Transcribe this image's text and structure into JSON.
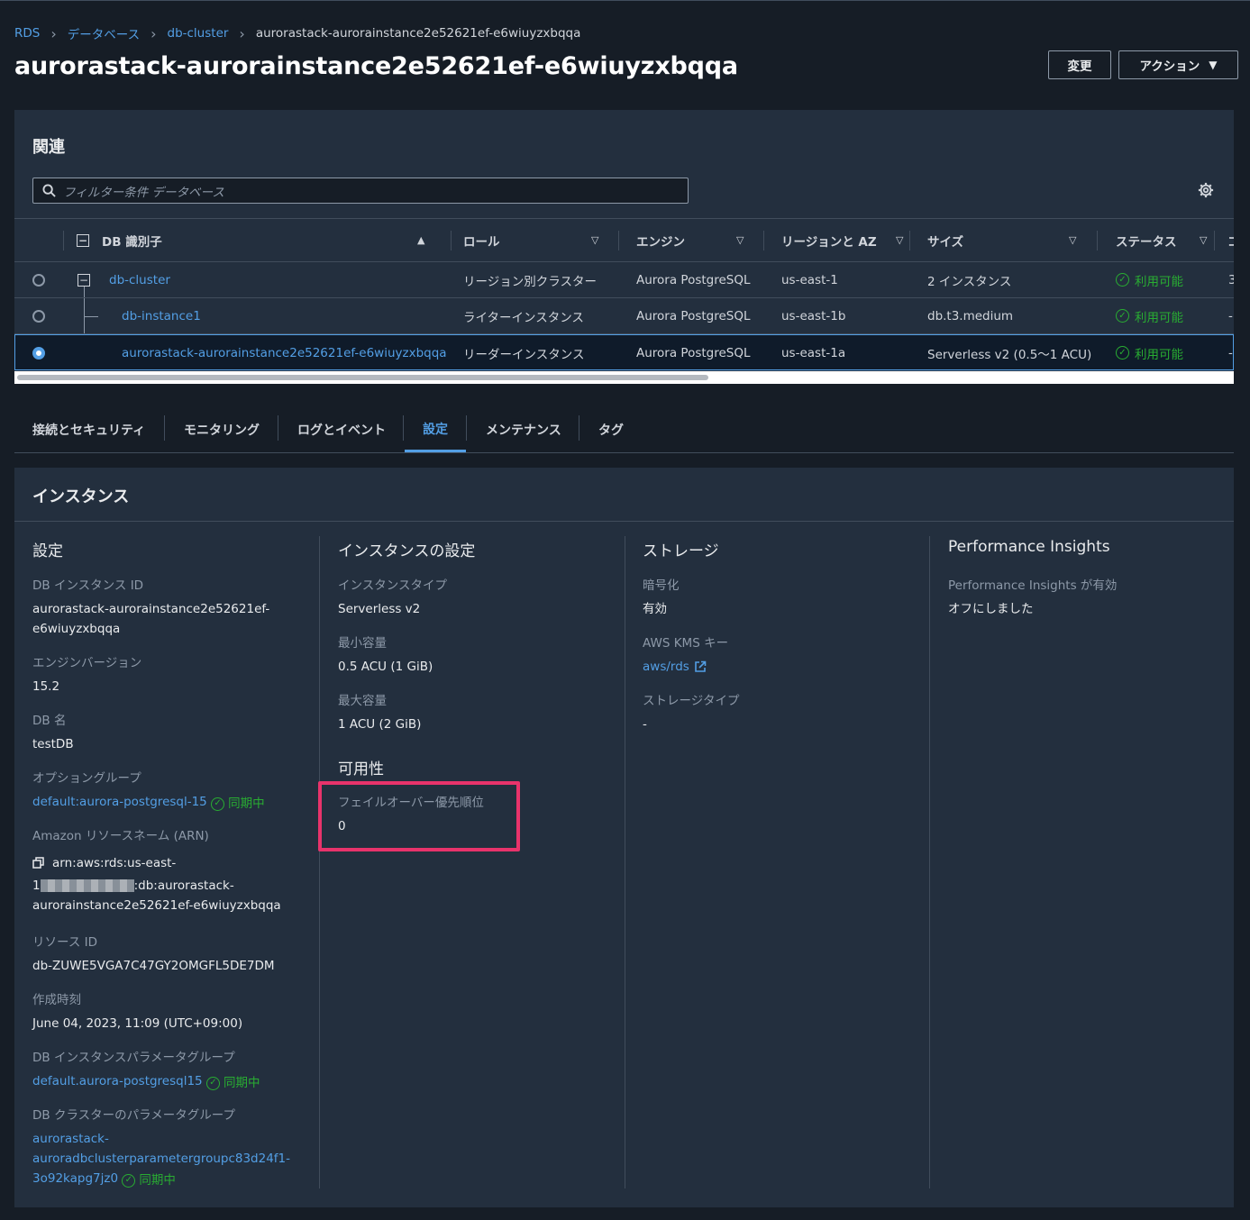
{
  "breadcrumb": {
    "rds": "RDS",
    "databases": "データベース",
    "cluster": "db-cluster",
    "current": "aurorastack-aurorainstance2e52621ef-e6wiuyzxbqqa",
    "separator": ">"
  },
  "page_title": "aurorastack-aurorainstance2e52621ef-e6wiuyzxbqqa",
  "header_buttons": {
    "change": "変更",
    "action": "アクション"
  },
  "related": {
    "title": "関連",
    "search_placeholder": "フィルター条件 データベース",
    "columns": {
      "id": "DB 識別子",
      "role": "ロール",
      "engine": "エンジン",
      "region": "リージョンと AZ",
      "size": "サイズ",
      "status": "ステータス"
    },
    "rows": [
      {
        "id": "db-cluster",
        "role": "リージョン別クラスター",
        "engine": "Aurora PostgreSQL",
        "region": "us-east-1",
        "size": "2 インスタンス",
        "status": "利用可能",
        "extra": "3"
      },
      {
        "id": "db-instance1",
        "role": "ライターインスタンス",
        "engine": "Aurora PostgreSQL",
        "region": "us-east-1b",
        "size": "db.t3.medium",
        "status": "利用可能",
        "extra": "-"
      },
      {
        "id": "aurorastack-aurorainstance2e52621ef-e6wiuyzxbqqa",
        "role": "リーダーインスタンス",
        "engine": "Aurora PostgreSQL",
        "region": "us-east-1a",
        "size": "Serverless v2 (0.5〜1 ACU)",
        "status": "利用可能",
        "extra": "-"
      }
    ]
  },
  "tabs": [
    "接続とセキュリティ",
    "モニタリング",
    "ログとイベント",
    "設定",
    "メンテナンス",
    "タグ"
  ],
  "active_tab": "設定",
  "instance": {
    "title": "インスタンス",
    "config": {
      "heading": "設定",
      "instance_id_label": "DB インスタンス ID",
      "instance_id_1": "aurorastack-aurorainstance2e52621ef-",
      "instance_id_2": "e6wiuyzxbqqa",
      "engine_version_label": "エンジンバージョン",
      "engine_version": "15.2",
      "db_name_label": "DB 名",
      "db_name": "testDB",
      "option_group_label": "オプショングループ",
      "option_group": "default:aurora-postgresql-15",
      "sync": "同期中",
      "arn_label": "Amazon リソースネーム (ARN)",
      "arn_1": "arn:aws:rds:us-east-",
      "arn_2a": "1",
      "arn_2b": ":db:aurorastack-",
      "arn_3": "aurorainstance2e52621ef-e6wiuyzxbqqa",
      "resource_id_label": "リソース ID",
      "resource_id": "db-ZUWE5VGA7C47GY2OMGFL5DE7DM",
      "created_label": "作成時刻",
      "created": "June 04, 2023, 11:09 (UTC+09:00)",
      "param_group_label": "DB インスタンスパラメータグループ",
      "param_group": "default.aurora-postgresql15",
      "cluster_param_label": "DB クラスターのパラメータグループ",
      "cluster_param_1": "aurorastack-",
      "cluster_param_2": "auroradbclusterparametergroupc83d24f1-",
      "cluster_param_3": "3o92kapg7jz0"
    },
    "instance_settings": {
      "heading": "インスタンスの設定",
      "type_label": "インスタンスタイプ",
      "type": "Serverless v2",
      "min_label": "最小容量",
      "min": "0.5 ACU (1 GiB)",
      "max_label": "最大容量",
      "max": "1 ACU (2 GiB)",
      "availability_heading": "可用性",
      "failover_label": "フェイルオーバー優先順位",
      "failover": "0"
    },
    "storage": {
      "heading": "ストレージ",
      "encryption_label": "暗号化",
      "encryption": "有効",
      "kms_label": "AWS KMS キー",
      "kms": "aws/rds",
      "type_label": "ストレージタイプ",
      "type": "-"
    },
    "pi": {
      "heading": "Performance Insights",
      "label": "Performance Insights が有効",
      "value": "オフにしました"
    }
  },
  "colors": {
    "link": "#539fe5",
    "success": "#29ad32",
    "highlight": "#e8336b",
    "panel": "#232f3e",
    "background": "#161d26"
  }
}
